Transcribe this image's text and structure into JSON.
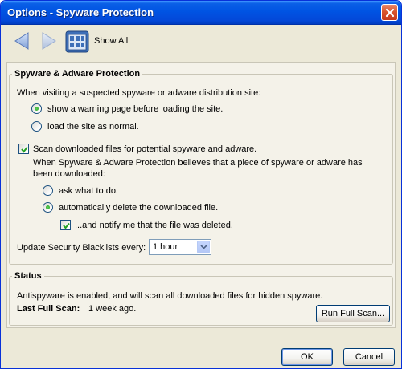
{
  "window": {
    "title": "Options - Spyware Protection"
  },
  "toolbar": {
    "back_icon": "back-arrow-icon",
    "forward_icon": "forward-arrow-icon",
    "show_all_icon": "show-all-grid-icon",
    "show_all_label": "Show All"
  },
  "spyware": {
    "group_title": "Spyware & Adware Protection",
    "visiting_prompt": "When visiting a suspected spyware or adware distribution site:",
    "visit_options": [
      {
        "label": "show a warning page before loading the site.",
        "selected": true
      },
      {
        "label": "load the site as normal.",
        "selected": false
      }
    ],
    "scan_downloads": {
      "label": "Scan downloaded files for potential spyware and adware.",
      "checked": true
    },
    "belief_text_line1": "When Spyware & Adware Protection believes that a piece of spyware or adware has",
    "belief_text_line2": "been downloaded:",
    "download_options": [
      {
        "label": "ask what to do.",
        "selected": false
      },
      {
        "label": "automatically delete the downloaded file.",
        "selected": true
      }
    ],
    "notify": {
      "label": "...and notify me that the file was deleted.",
      "checked": true
    },
    "update_label": "Update Security Blacklists every:",
    "update_value": "1 hour"
  },
  "status": {
    "group_title": "Status",
    "message": "Antispyware is enabled, and will scan all downloaded files for hidden spyware.",
    "last_scan_label": "Last Full Scan:",
    "last_scan_value": "1 week ago.",
    "run_scan_button": "Run Full Scan..."
  },
  "footer": {
    "ok_label": "OK",
    "cancel_label": "Cancel"
  },
  "colors": {
    "titlebar": "#0054e3",
    "window_bg": "#ece9d8",
    "panel_bg": "#f4f2e9",
    "radio_selected": "#21a121",
    "check_mark": "#21a121"
  }
}
